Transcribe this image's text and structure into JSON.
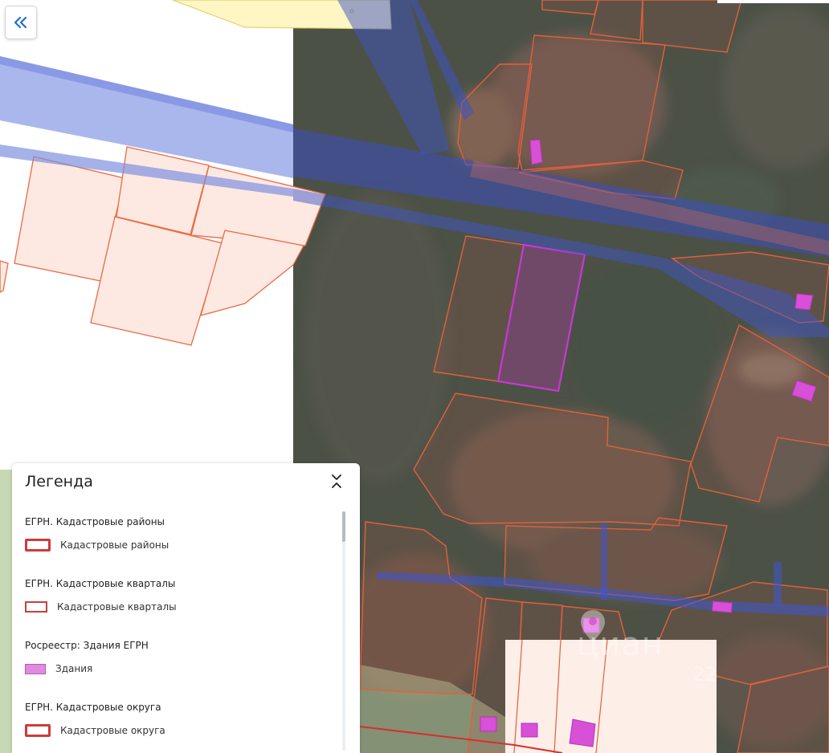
{
  "legend": {
    "title": "Легенда",
    "groups": [
      {
        "title": "ЕГРН. Кадастровые районы",
        "item": "Кадастровые районы",
        "swatch_fill": "#ffffff",
        "swatch_stroke": "#d03a3a"
      },
      {
        "title": "ЕГРН. Кадастровые кварталы",
        "item": "Кадастровые кварталы",
        "swatch_fill": "#ffffff",
        "swatch_stroke": "#c94040"
      },
      {
        "title": "Росреестр: Здания ЕГРН",
        "item": "Здания",
        "swatch_fill": "#e08be0",
        "swatch_stroke": "#b35bb3"
      },
      {
        "title": "ЕГРН. Кадастровые округа",
        "item": "Кадастровые округа",
        "swatch_fill": "#ffffff",
        "swatch_stroke": "#d03a3a"
      }
    ]
  },
  "controls": {
    "collapse_icon": "double-chevron-left-icon",
    "legend_toggle_icon": "collapse-expand-icon"
  },
  "watermark": {
    "text": "циан",
    "number": "22"
  },
  "colors": {
    "parcel_fill": "#fde8e1",
    "parcel_stroke": "#e8603a",
    "building_fill": "#d84fd8",
    "road_fill": "#8e9fe6",
    "satellite_base": "#4a4f44",
    "yellow_zone": "#fff7c2",
    "green_zone": "#b6c99b"
  }
}
